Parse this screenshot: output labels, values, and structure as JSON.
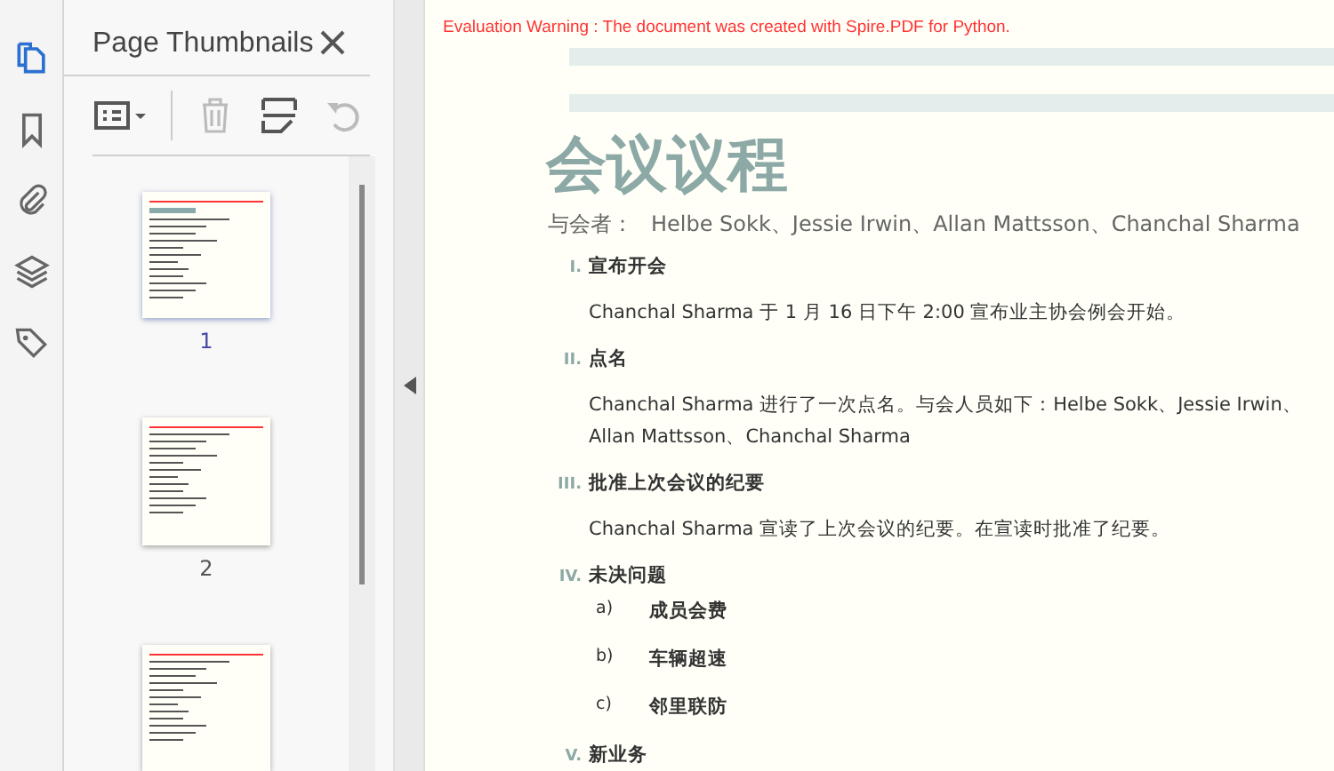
{
  "rail": [
    {
      "kind": "pages",
      "selected": true
    },
    {
      "kind": "bookmark",
      "selected": false
    },
    {
      "kind": "attachment",
      "selected": false
    },
    {
      "kind": "layers",
      "selected": false
    },
    {
      "kind": "tags",
      "selected": false
    }
  ],
  "panel": {
    "title": "Page Thumbnails",
    "tools": [
      {
        "kind": "options",
        "disabled": false
      },
      {
        "kind": "delete",
        "disabled": true
      },
      {
        "kind": "insert",
        "disabled": false
      },
      {
        "kind": "rotate",
        "disabled": true
      }
    ],
    "thumbnails": [
      {
        "label": "1",
        "selected": true
      },
      {
        "label": "2",
        "selected": false
      },
      {
        "selected": false
      }
    ]
  },
  "document": {
    "warning": "Evaluation Warning : The document was created with Spire.PDF for Python.",
    "title": "会议议程",
    "attendees_label": "与会者：",
    "attendees": "Helbe Sokk、Jessie Irwin、Allan Mattsson、Chanchal Sharma",
    "sections": [
      {
        "numeral": "I.",
        "heading": "宣布开会",
        "body": "Chanchal Sharma 于 1 月 16 日下午 2:00 宣布业主协会例会开始。"
      },
      {
        "numeral": "II.",
        "heading": "点名",
        "body": "Chanchal Sharma 进行了一次点名。与会人员如下：Helbe Sokk、Jessie Irwin、Allan Mattsson、Chanchal Sharma"
      },
      {
        "numeral": "III.",
        "heading": "批准上次会议的纪要",
        "body": "Chanchal Sharma 宣读了上次会议的纪要。在宣读时批准了纪要。"
      },
      {
        "numeral": "IV.",
        "heading": "未决问题",
        "items": [
          {
            "marker": "a)",
            "text": "成员会费"
          },
          {
            "marker": "b)",
            "text": "车辆超速"
          },
          {
            "marker": "c)",
            "text": "邻里联防"
          }
        ]
      },
      {
        "numeral": "V.",
        "heading": "新业务"
      }
    ]
  }
}
